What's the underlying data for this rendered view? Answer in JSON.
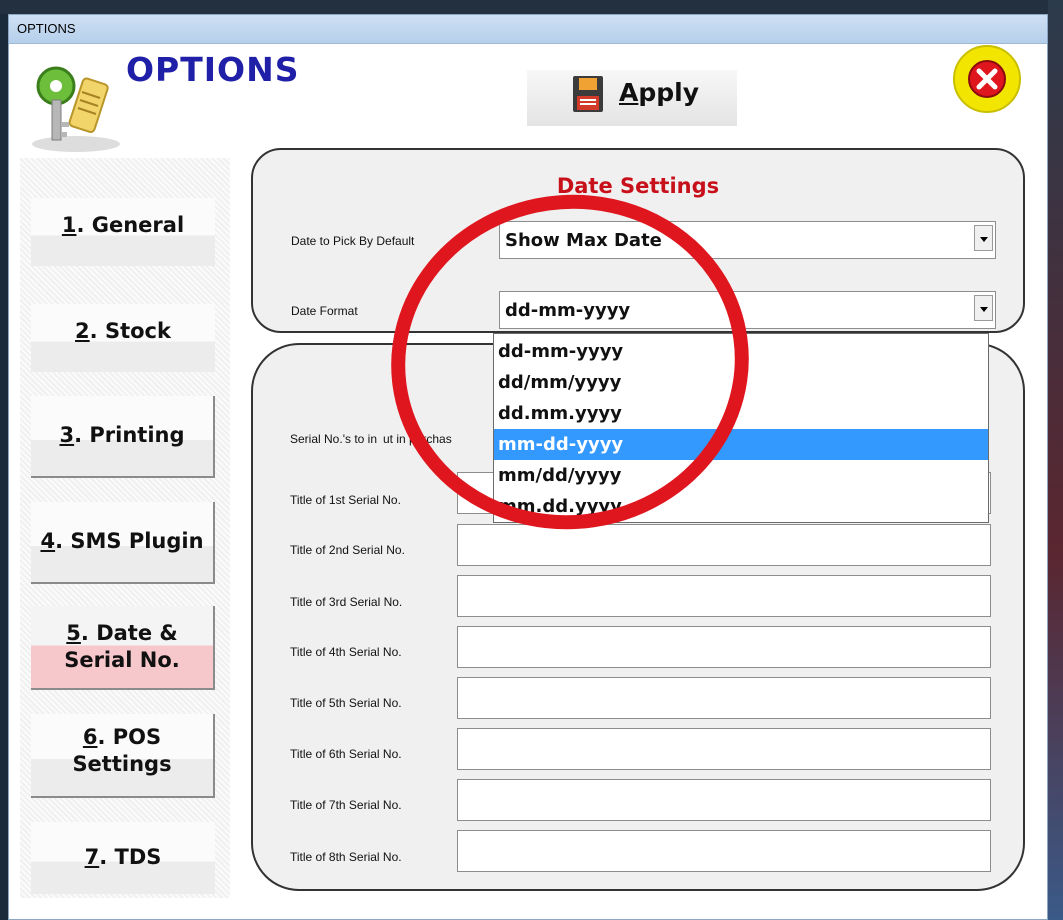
{
  "window": {
    "title": "OPTIONS"
  },
  "header": {
    "title": "OPTIONS",
    "apply_label": "Apply",
    "apply_mnemonic": "A",
    "apply_rest": "pply"
  },
  "nav": {
    "items": [
      {
        "key": "1",
        "label": ". General"
      },
      {
        "key": "2",
        "label": ". Stock"
      },
      {
        "key": "3",
        "label": ". Printing"
      },
      {
        "key": "4",
        "label": ". SMS Plugin"
      },
      {
        "key": "5",
        "label": ". Date &",
        "label2": "Serial No."
      },
      {
        "key": "6",
        "label": ". POS",
        "label2": "Settings"
      },
      {
        "key": "7",
        "label": ". TDS"
      }
    ]
  },
  "date_settings": {
    "title": "Date Settings",
    "pick_label": "Date to Pick By Default",
    "pick_value": "Show Max Date",
    "format_label": "Date Format",
    "format_value": "dd-mm-yyyy",
    "format_options": [
      "dd-mm-yyyy",
      "dd/mm/yyyy",
      "dd.mm.yyyy",
      "mm-dd-yyyy",
      "mm/dd/yyyy",
      "mm.dd.yyyy"
    ],
    "highlighted_option": "mm-dd-yyyy"
  },
  "serial": {
    "input_label_part1": "Serial No.'s to in",
    "input_label_part2": "ut in purchas",
    "titles": [
      "Title of 1st Serial No.",
      "Title of 2nd Serial No.",
      "Title of 3rd Serial No.",
      "Title of 4th Serial No.",
      "Title of 5th Serial No.",
      "Title of 6th Serial No.",
      "Title of 7th Serial No.",
      "Title of 8th Serial No."
    ]
  },
  "colors": {
    "accent_title": "#1f1fa8",
    "section_title": "#c8101a",
    "highlight": "#3399ff",
    "annotation": "#e0161e"
  }
}
